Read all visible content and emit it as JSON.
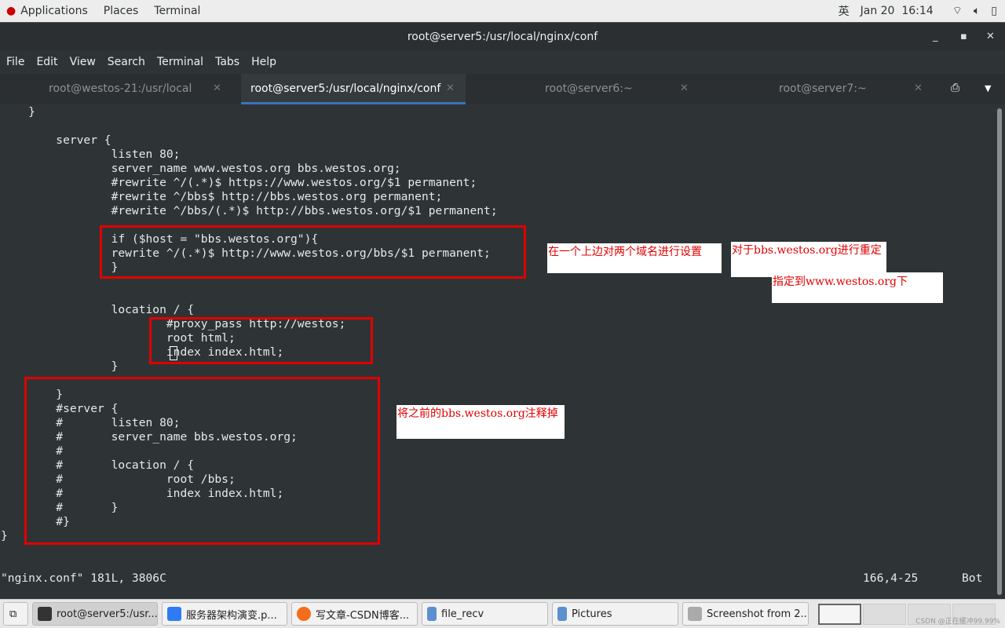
{
  "topbar": {
    "applications": "Applications",
    "places": "Places",
    "terminal": "Terminal",
    "ime": "英",
    "datetime": "Jan 20  16:14"
  },
  "window": {
    "title": "root@server5:/usr/local/nginx/conf"
  },
  "menu": [
    "File",
    "Edit",
    "View",
    "Search",
    "Terminal",
    "Tabs",
    "Help"
  ],
  "tabs": [
    {
      "label": "root@westos-21:/usr/local"
    },
    {
      "label": "root@server5:/usr/local/nginx/conf"
    },
    {
      "label": "root@server6:~"
    },
    {
      "label": "root@server7:~"
    }
  ],
  "editor": {
    "content": "    }\n\n        server {\n                listen 80;\n                server_name www.westos.org bbs.westos.org;\n                #rewrite ^/(.*)$ https://www.westos.org/$1 permanent;\n                #rewrite ^/bbs$ http://bbs.westos.org permanent;\n                #rewrite ^/bbs/(.*)$ http://bbs.westos.org/$1 permanent;\n\n                if ($host = \"bbs.westos.org\"){\n                rewrite ^/(.*)$ http://www.westos.org/bbs/$1 permanent;\n                }\n\n\n                location / {\n                        #proxy_pass http://westos;\n                        root html;\n                        index index.html;\n                }\n\n        }\n        #server {\n        #       listen 80;\n        #       server_name bbs.westos.org;\n        #\n        #       location / {\n        #               root /bbs;\n        #               index index.html;\n        #       }\n        #}\n}",
    "status_file": "\"nginx.conf\" 181L, 3806C",
    "status_pos": "166,4-25",
    "status_scroll": "Bot"
  },
  "annotations": {
    "note1": "在一个上边对两个域名进行设置",
    "note2": "对于bbs.westos.org进行重定",
    "note3": "指定到www.westos.org下",
    "note4": "将之前的bbs.westos.org注释掉"
  },
  "taskbar": {
    "items": [
      "root@server5:/usr...",
      "服务器架构演变.p...",
      "写文章-CSDN博客...",
      "file_recv",
      "Pictures",
      "Screenshot from 2..."
    ],
    "watermark": "CSDN @正在缓冲99.99%"
  }
}
